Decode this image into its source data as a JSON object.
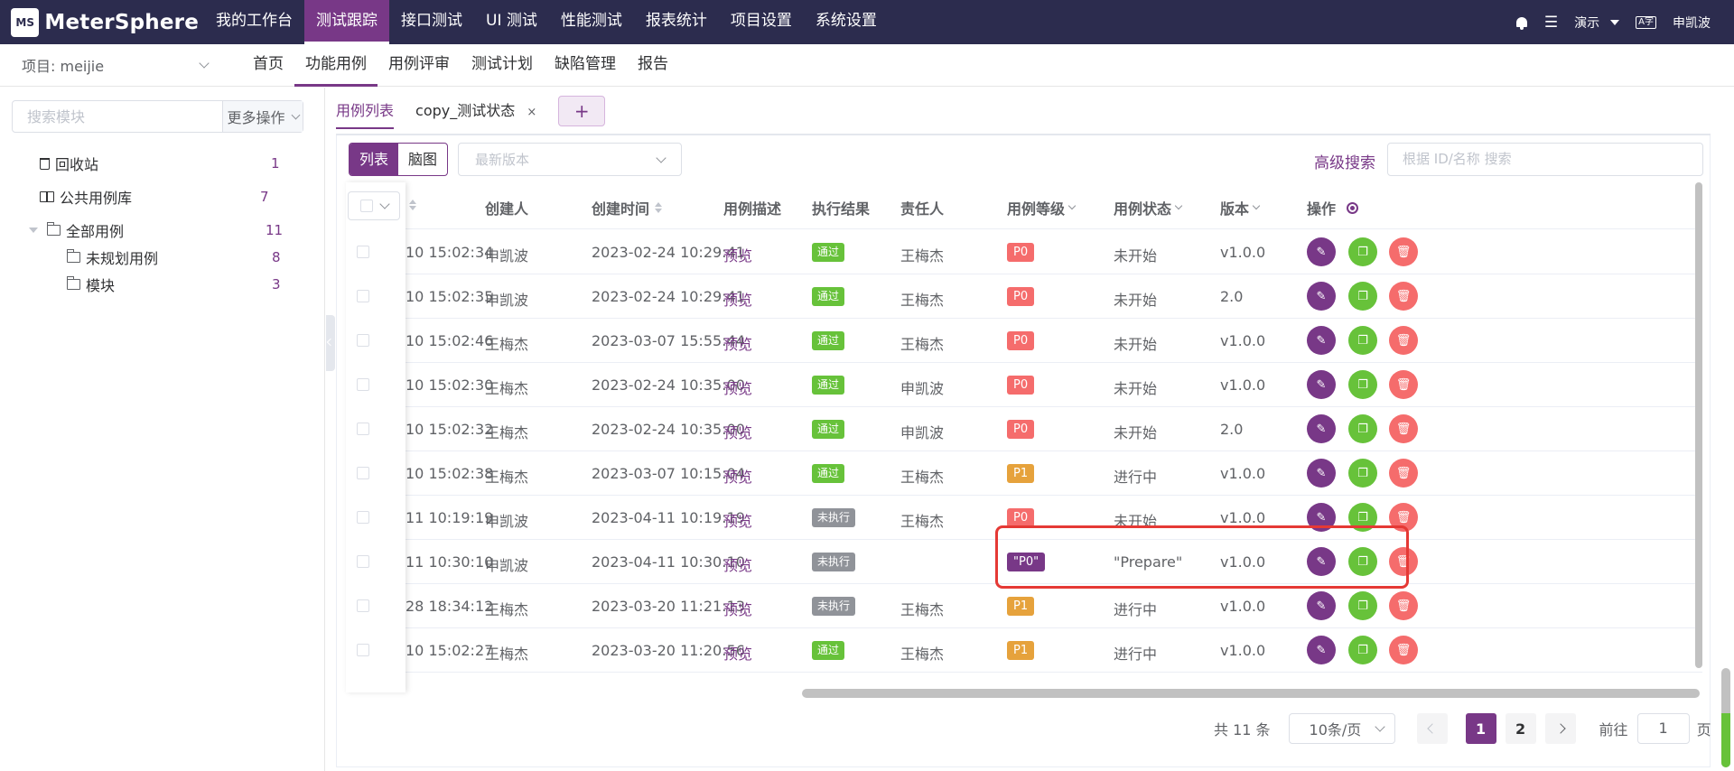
{
  "app": {
    "logo_mark": "MS",
    "name": "MeterSphere"
  },
  "topnav": [
    {
      "label": "我的工作台"
    },
    {
      "label": "测试跟踪",
      "active": true
    },
    {
      "label": "接口测试"
    },
    {
      "label": "UI 测试"
    },
    {
      "label": "性能测试"
    },
    {
      "label": "报表统计"
    },
    {
      "label": "项目设置"
    },
    {
      "label": "系统设置"
    }
  ],
  "topright": {
    "workspace": "演示",
    "lang": "A字",
    "user": "申凯波"
  },
  "project": {
    "label": "项目: meijie"
  },
  "subnav": [
    {
      "label": "首页"
    },
    {
      "label": "功能用例",
      "active": true
    },
    {
      "label": "用例评审"
    },
    {
      "label": "测试计划"
    },
    {
      "label": "缺陷管理"
    },
    {
      "label": "报告"
    }
  ],
  "left": {
    "search_placeholder": "搜索模块",
    "more_label": "更多操作",
    "recycle": {
      "label": "回收站",
      "count": "1"
    },
    "public": {
      "label": "公共用例库",
      "count": "7"
    },
    "all": {
      "label": "全部用例",
      "count": "11"
    },
    "unplanned": {
      "label": "未规划用例",
      "count": "8"
    },
    "module": {
      "label": "模块",
      "count": "3"
    }
  },
  "tabs": {
    "list": "用例列表",
    "copy": "copy_测试状态",
    "close": "×",
    "add": "+"
  },
  "toolbar": {
    "view_list": "列表",
    "view_mind": "脑图",
    "version_placeholder": "最新版本",
    "advanced": "高级搜索",
    "search_placeholder": "根据 ID/名称 搜索"
  },
  "columns": {
    "creator": "创建人",
    "create_time": "创建时间",
    "desc": "用例描述",
    "result": "执行结果",
    "owner": "责任人",
    "level": "用例等级",
    "status": "用例状态",
    "version": "版本",
    "ops": "操作"
  },
  "rows": [
    {
      "update": "10 15:02:34",
      "creator": "申凯波",
      "created": "2023-02-24 10:29:41",
      "desc": "预览",
      "result": "通过",
      "result_type": "pass",
      "owner": "王梅杰",
      "level": "P0",
      "level_type": "p0",
      "status": "未开始",
      "version": "v1.0.0"
    },
    {
      "update": "10 15:02:35",
      "creator": "申凯波",
      "created": "2023-02-24 10:29:41",
      "desc": "预览",
      "result": "通过",
      "result_type": "pass",
      "owner": "王梅杰",
      "level": "P0",
      "level_type": "p0",
      "status": "未开始",
      "version": "2.0"
    },
    {
      "update": "10 15:02:46",
      "creator": "王梅杰",
      "created": "2023-03-07 15:55:44",
      "desc": "预览",
      "result": "通过",
      "result_type": "pass",
      "owner": "王梅杰",
      "level": "P0",
      "level_type": "p0",
      "status": "未开始",
      "version": "v1.0.0"
    },
    {
      "update": "10 15:02:30",
      "creator": "王梅杰",
      "created": "2023-02-24 10:35:00",
      "desc": "预览",
      "result": "通过",
      "result_type": "pass",
      "owner": "申凯波",
      "level": "P0",
      "level_type": "p0",
      "status": "未开始",
      "version": "v1.0.0"
    },
    {
      "update": "10 15:02:32",
      "creator": "王梅杰",
      "created": "2023-02-24 10:35:00",
      "desc": "预览",
      "result": "通过",
      "result_type": "pass",
      "owner": "申凯波",
      "level": "P0",
      "level_type": "p0",
      "status": "未开始",
      "version": "2.0"
    },
    {
      "update": "10 15:02:38",
      "creator": "王梅杰",
      "created": "2023-03-07 10:15:04",
      "desc": "预览",
      "result": "通过",
      "result_type": "pass",
      "owner": "王梅杰",
      "level": "P1",
      "level_type": "p1",
      "status": "进行中",
      "version": "v1.0.0"
    },
    {
      "update": "11 10:19:19",
      "creator": "申凯波",
      "created": "2023-04-11 10:19:19",
      "desc": "预览",
      "result": "未执行",
      "result_type": "none",
      "owner": "王梅杰",
      "level": "P0",
      "level_type": "p0",
      "status": "未开始",
      "version": "v1.0.0"
    },
    {
      "update": "11 10:30:10",
      "creator": "申凯波",
      "created": "2023-04-11 10:30:10",
      "desc": "预览",
      "result": "未执行",
      "result_type": "none",
      "owner": "",
      "level": "\"P0\"",
      "level_type": "pq",
      "status": "\"Prepare\"",
      "version": "v1.0.0"
    },
    {
      "update": "28 18:34:12",
      "creator": "王梅杰",
      "created": "2023-03-20 11:21:13",
      "desc": "预览",
      "result": "未执行",
      "result_type": "none",
      "owner": "王梅杰",
      "level": "P1",
      "level_type": "p1",
      "status": "进行中",
      "version": "v1.0.0"
    },
    {
      "update": "10 15:02:27",
      "creator": "王梅杰",
      "created": "2023-03-20 11:20:56",
      "desc": "预览",
      "result": "通过",
      "result_type": "pass",
      "owner": "王梅杰",
      "level": "P1",
      "level_type": "p1",
      "status": "进行中",
      "version": "v1.0.0"
    }
  ],
  "pager": {
    "total": "共 11 条",
    "size": "10条/页",
    "page1": "1",
    "page2": "2",
    "goto": "前往",
    "goto_value": "1",
    "page_unit": "页"
  },
  "colors": {
    "brand": "#783887",
    "topbar": "#2c2c4e",
    "pass": "#67c23a",
    "danger": "#f56c6c",
    "warning": "#e6a23c"
  }
}
